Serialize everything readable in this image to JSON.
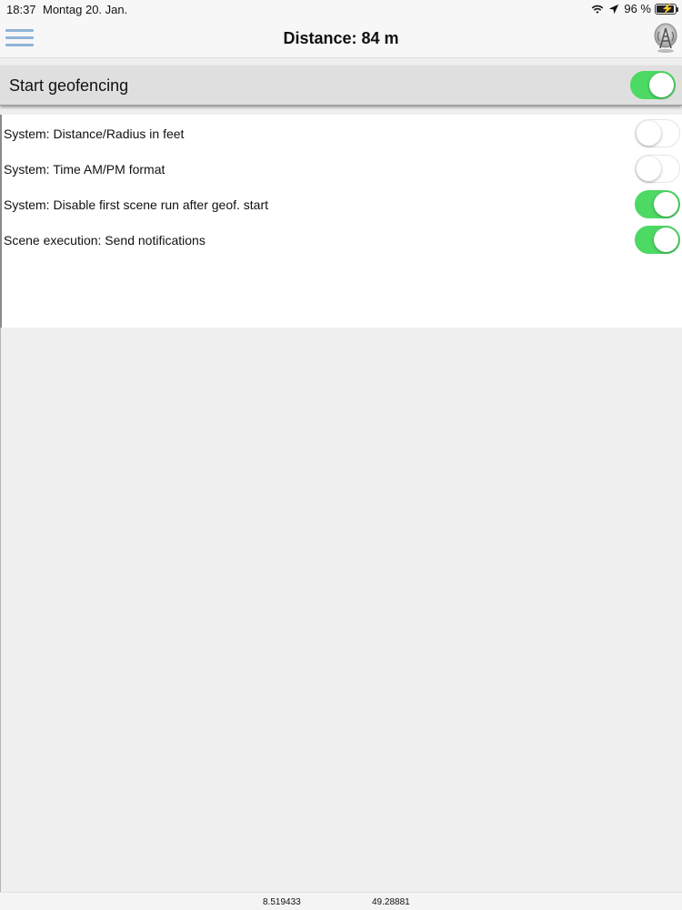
{
  "status_bar": {
    "time": "18:37",
    "date": "Montag 20. Jan.",
    "battery": "96 %"
  },
  "nav": {
    "title": "Distance: 84 m",
    "menu_icon": "hamburger-menu-icon",
    "right_icon": "geofence-antenna-icon"
  },
  "geofence": {
    "label": "Start geofencing",
    "enabled": true
  },
  "settings": [
    {
      "label": "System: Distance/Radius in feet",
      "enabled": false
    },
    {
      "label": "System: Time AM/PM format",
      "enabled": false
    },
    {
      "label": "System: Disable first scene run after geof. start",
      "enabled": true
    },
    {
      "label": "Scene execution: Send notifications",
      "enabled": true
    }
  ],
  "coordinates": {
    "longitude": "8.519433",
    "latitude": "49.28881"
  },
  "colors": {
    "toggle_on": "#4cd964",
    "menu_icon": "#8fb4d8"
  }
}
